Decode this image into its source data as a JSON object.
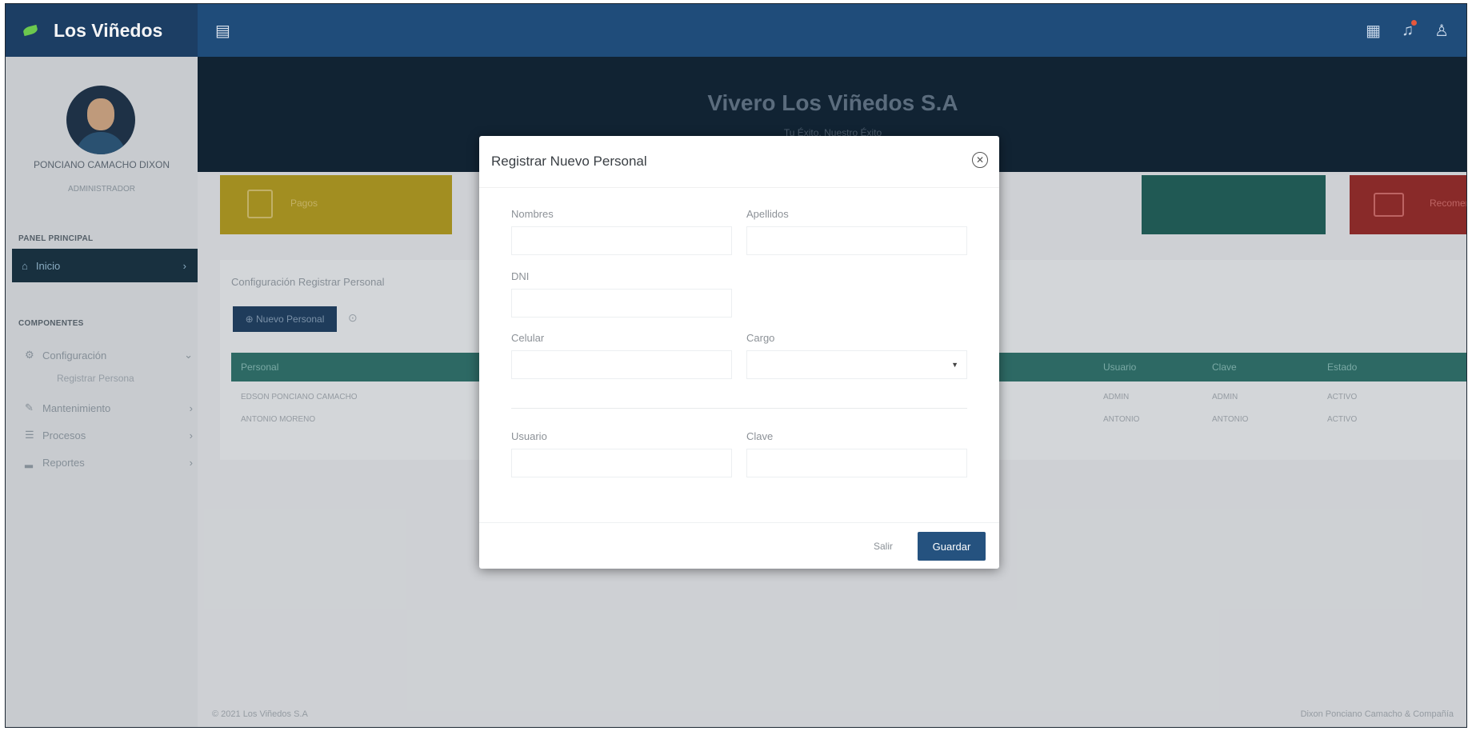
{
  "header": {
    "brand": "Los Viñedos",
    "menu_icon": "menu-icon",
    "icons": [
      "grid-icon",
      "bell-icon",
      "user-icon"
    ]
  },
  "sidebar": {
    "user_name": "PONCIANO CAMACHO DIXON",
    "user_role": "ADMINISTRADOR",
    "section_main": "PANEL PRINCIPAL",
    "inicio": "Inicio",
    "section_components": "COMPONENTES",
    "items": [
      {
        "label": "Configuración",
        "icon": "settings-icon"
      },
      {
        "label": "Mantenimiento",
        "icon": "wrench-icon"
      },
      {
        "label": "Procesos",
        "icon": "list-icon"
      },
      {
        "label": "Reportes",
        "icon": "chart-icon"
      }
    ],
    "sub_item": "Registrar Persona"
  },
  "hero": {
    "title": "Vivero Los Viñedos S.A",
    "subtitle": "Tu Éxito, Nuestro Éxito"
  },
  "cards": {
    "yellow": "Pagos",
    "red": "Recomendaciones"
  },
  "panel": {
    "title": "Configuración Registrar Personal",
    "new_button": "⊕ Nuevo Personal",
    "columns": [
      "Personal",
      "Usuario",
      "Clave",
      "Estado"
    ],
    "rows": [
      {
        "personal": "EDSON PONCIANO CAMACHO",
        "usuario": "ADMIN",
        "clave": "ADMIN",
        "estado": "ACTIVO"
      },
      {
        "personal": "ANTONIO MORENO",
        "usuario": "ANTONIO",
        "clave": "ANTONIO",
        "estado": "ACTIVO"
      }
    ]
  },
  "footer": {
    "left": "© 2021 Los Viñedos S.A",
    "right": "Dixon Ponciano Camacho & Compañía"
  },
  "modal": {
    "title": "Registrar Nuevo Personal",
    "labels": {
      "nombres": "Nombres",
      "apellidos": "Apellidos",
      "dni": "DNI",
      "celular": "Celular",
      "cargo": "Cargo",
      "usuario": "Usuario",
      "clave": "Clave"
    },
    "values": {
      "nombres": "",
      "apellidos": "",
      "dni": "",
      "celular": "",
      "cargo": "",
      "usuario": "",
      "clave": ""
    },
    "cancel": "Salir",
    "save": "Guardar"
  }
}
